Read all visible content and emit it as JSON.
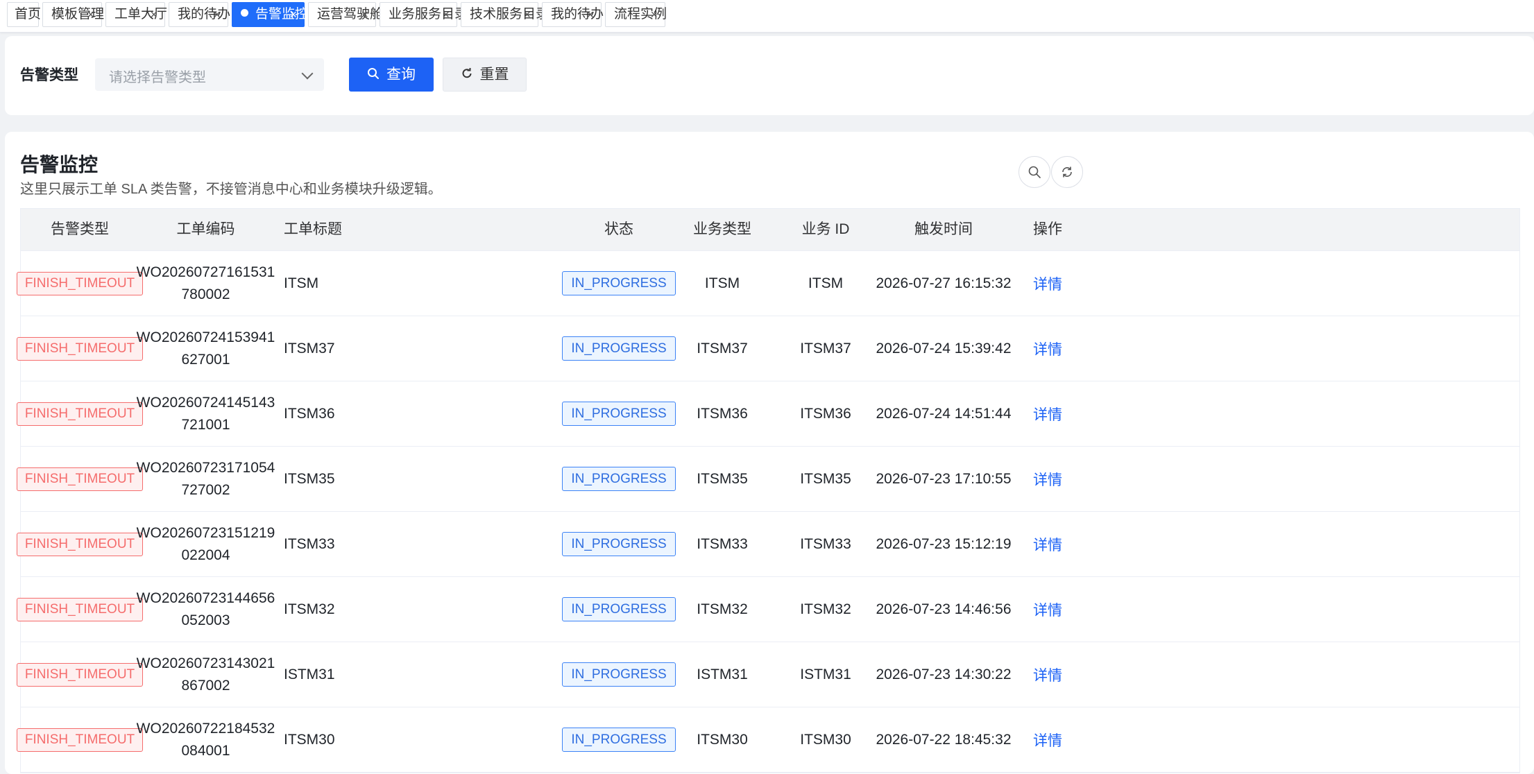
{
  "tabs": [
    {
      "label": "首页",
      "closable": false,
      "active": false
    },
    {
      "label": "模板管理",
      "closable": true,
      "active": false
    },
    {
      "label": "工单大厅",
      "closable": true,
      "active": false
    },
    {
      "label": "我的待办",
      "closable": true,
      "active": false
    },
    {
      "label": "告警监控",
      "closable": true,
      "active": true
    },
    {
      "label": "运营驾驶舱",
      "closable": true,
      "active": false
    },
    {
      "label": "业务服务目录",
      "closable": true,
      "active": false
    },
    {
      "label": "技术服务目录",
      "closable": true,
      "active": false
    },
    {
      "label": "我的待办",
      "closable": true,
      "active": false
    },
    {
      "label": "流程实例",
      "closable": true,
      "active": false
    }
  ],
  "filter": {
    "label": "告警类型",
    "placeholder": "请选择告警类型",
    "query_label": "查询",
    "reset_label": "重置"
  },
  "page": {
    "title": "告警监控",
    "description": "这里只展示工单 SLA 类告警，不接管消息中心和业务模块升级逻辑。"
  },
  "table": {
    "columns": [
      "告警类型",
      "工单编码",
      "工单标题",
      "状态",
      "业务类型",
      "业务 ID",
      "触发时间",
      "操作"
    ],
    "rows": [
      {
        "alert_type": "FINISH_TIMEOUT",
        "code_line1": "WO20260727161531",
        "code_line2": "780002",
        "title": "ITSM",
        "status": "IN_PROGRESS",
        "biz_type": "ITSM",
        "biz_id": "ITSM",
        "time": "2026-07-27 16:15:32",
        "action": "详情"
      },
      {
        "alert_type": "FINISH_TIMEOUT",
        "code_line1": "WO20260724153941",
        "code_line2": "627001",
        "title": "ITSM37",
        "status": "IN_PROGRESS",
        "biz_type": "ITSM37",
        "biz_id": "ITSM37",
        "time": "2026-07-24 15:39:42",
        "action": "详情"
      },
      {
        "alert_type": "FINISH_TIMEOUT",
        "code_line1": "WO20260724145143",
        "code_line2": "721001",
        "title": "ITSM36",
        "status": "IN_PROGRESS",
        "biz_type": "ITSM36",
        "biz_id": "ITSM36",
        "time": "2026-07-24 14:51:44",
        "action": "详情"
      },
      {
        "alert_type": "FINISH_TIMEOUT",
        "code_line1": "WO20260723171054",
        "code_line2": "727002",
        "title": "ITSM35",
        "status": "IN_PROGRESS",
        "biz_type": "ITSM35",
        "biz_id": "ITSM35",
        "time": "2026-07-23 17:10:55",
        "action": "详情"
      },
      {
        "alert_type": "FINISH_TIMEOUT",
        "code_line1": "WO20260723151219",
        "code_line2": "022004",
        "title": "ITSM33",
        "status": "IN_PROGRESS",
        "biz_type": "ITSM33",
        "biz_id": "ITSM33",
        "time": "2026-07-23 15:12:19",
        "action": "详情"
      },
      {
        "alert_type": "FINISH_TIMEOUT",
        "code_line1": "WO20260723144656",
        "code_line2": "052003",
        "title": "ITSM32",
        "status": "IN_PROGRESS",
        "biz_type": "ITSM32",
        "biz_id": "ITSM32",
        "time": "2026-07-23 14:46:56",
        "action": "详情"
      },
      {
        "alert_type": "FINISH_TIMEOUT",
        "code_line1": "WO20260723143021",
        "code_line2": "867002",
        "title": "ISTM31",
        "status": "IN_PROGRESS",
        "biz_type": "ISTM31",
        "biz_id": "ISTM31",
        "time": "2026-07-23 14:30:22",
        "action": "详情"
      },
      {
        "alert_type": "FINISH_TIMEOUT",
        "code_line1": "WO20260722184532",
        "code_line2": "084001",
        "title": "ITSM30",
        "status": "IN_PROGRESS",
        "biz_type": "ITSM30",
        "biz_id": "ITSM30",
        "time": "2026-07-22 18:45:32",
        "action": "详情"
      }
    ]
  },
  "colors": {
    "primary": "#1d62f5",
    "danger": "#f56c6c",
    "status_blue": "#2f6ee0"
  },
  "icons": {
    "search_button": "search-icon",
    "reset_button": "refresh-icon",
    "toolbar_search": "search-icon",
    "toolbar_refresh": "refresh-icon",
    "select_arrow": "chevron-down-icon",
    "tab_close": "close-icon"
  }
}
